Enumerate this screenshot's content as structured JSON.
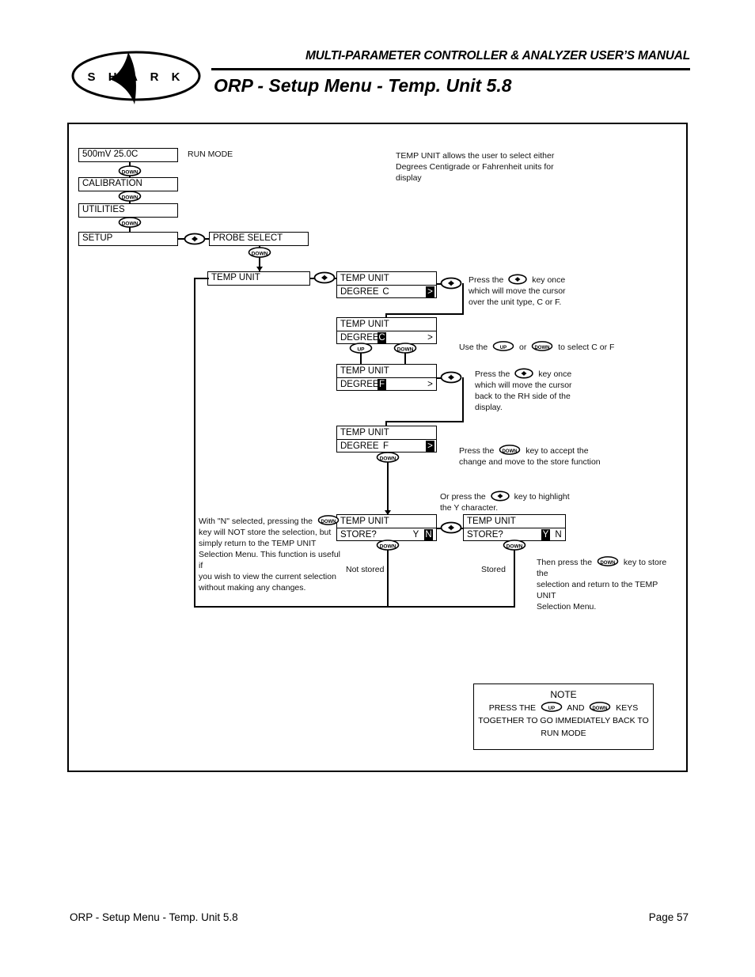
{
  "header": {
    "manual_title": "MULTI-PARAMETER CONTROLLER & ANALYZER USER’S MANUAL",
    "page_title": "ORP - Setup Menu - Temp. Unit 5.8",
    "logo_text": "S H A R K"
  },
  "footer": {
    "left": "ORP - Setup Menu - Temp. Unit 5.8",
    "right": "Page 57"
  },
  "keys": {
    "down": "DOWN",
    "up": "UP",
    "leftright": "◀▶"
  },
  "menu_chain": {
    "run_display": "500mV   25.0C",
    "run_mode_label": "RUN MODE",
    "calibration": "CALIBRATION",
    "utilities": "UTILITIES",
    "setup": "SETUP",
    "probe_select": "PROBE SELECT",
    "temp_unit": "TEMP UNIT"
  },
  "intro_text": "TEMP UNIT allows the user to select either Degrees Centigrade or Fahrenheit units for display",
  "panels": {
    "p1": {
      "line1": "TEMP UNIT",
      "line2_label": "DEGREE",
      "value": "C",
      "cursor": ">",
      "cursor_pos": "right"
    },
    "p2": {
      "line1": "TEMP UNIT",
      "line2_label": "DEGREE",
      "value": "C",
      "cursor": ">",
      "cursor_pos": "value"
    },
    "p3": {
      "line1": "TEMP UNIT",
      "line2_label": "DEGREE",
      "value": "F",
      "cursor": ">",
      "cursor_pos": "value"
    },
    "p4": {
      "line1": "TEMP UNIT",
      "line2_label": "DEGREE",
      "value": "F",
      "cursor": ">",
      "cursor_pos": "right"
    },
    "p5": {
      "line1": "TEMP UNIT",
      "line2_label": "STORE?",
      "yes": "Y",
      "no": "N",
      "selected": "N"
    },
    "p6": {
      "line1": "TEMP UNIT",
      "line2_label": "STORE?",
      "yes": "Y",
      "no": "N",
      "selected": "Y"
    }
  },
  "callouts": {
    "c1_a": "Press the",
    "c1_b": "key once",
    "c1_c": "which will move the cursor",
    "c1_d": "over the unit type, C or F.",
    "c2_a": "Use the",
    "c2_b": "or",
    "c2_c": "to select C or F",
    "c3_a": "Press the",
    "c3_b": "key once",
    "c3_c": "which will move the cursor",
    "c3_d": "back to the RH side of the",
    "c3_e": "display.",
    "c4_a": "Press the",
    "c4_b": "key to accept the",
    "c4_c": "change and move to the store function",
    "c5_a": "Or press the",
    "c5_b": "key to highlight",
    "c5_c": "the Y character.",
    "c6_a": "With \"N\" selected, pressing the",
    "c6_b": "key will NOT store the selection, but",
    "c6_c": "simply return to the TEMP UNIT",
    "c6_d": "Selection Menu. This function is useful if",
    "c6_e": "you wish to view the current selection",
    "c6_f": "without making any changes.",
    "c7_a": "Then press the",
    "c7_b": "key to store the",
    "c7_c": "selection and return to the TEMP UNIT",
    "c7_d": "Selection Menu.",
    "not_stored": "Not stored",
    "stored": "Stored"
  },
  "note": {
    "title": "NOTE",
    "l1_a": "PRESS THE",
    "l1_b": "AND",
    "l1_c": "KEYS",
    "l2": "TOGETHER TO GO IMMEDIATELY BACK TO",
    "l3": "RUN MODE"
  }
}
